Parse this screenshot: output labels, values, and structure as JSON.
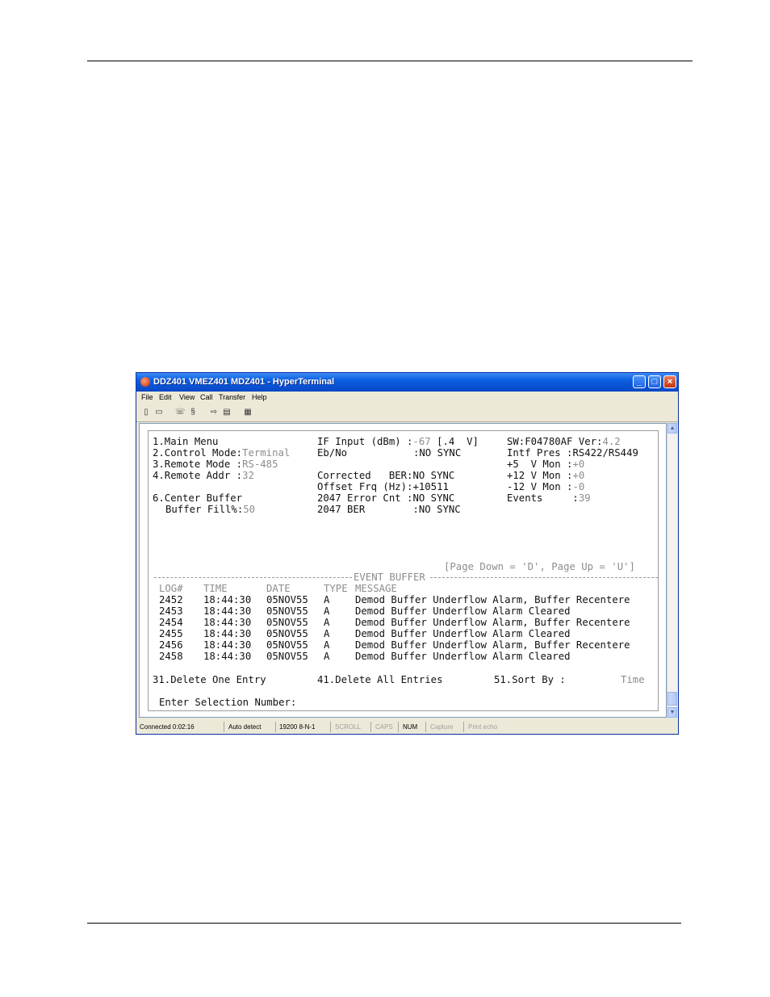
{
  "window": {
    "title": "DDZ401 VMEZ401 MDZ401 - HyperTerminal",
    "controls": {
      "minimize": "_",
      "maximize": "□",
      "close": "×"
    }
  },
  "menu": [
    "File",
    "Edit",
    "View",
    "Call",
    "Transfer",
    "Help"
  ],
  "toolbar_icons": [
    "new-icon",
    "open-icon",
    "disconnect-icon",
    "connect-icon",
    "send-icon",
    "receive-icon",
    "properties-icon"
  ],
  "terminal": {
    "menu_items": {
      "main_menu": "1.Main Menu",
      "control_mode_label": "2.Control Mode:",
      "control_mode_value": "Terminal",
      "remote_mode_label": "3.Remote Mode :",
      "remote_mode_value": "RS-485",
      "remote_addr_label": "4.Remote Addr :",
      "remote_addr_value": "32",
      "center_buffer": "6.Center Buffer",
      "buffer_fill_label": "Buffer Fill%:",
      "buffer_fill_value": "50"
    },
    "status": {
      "if_input_label": "IF Input (dBm) :",
      "if_input_value": "-67",
      "if_input_extra": "[.4  V]",
      "ebno_label": "Eb/No",
      "ebno_value": ":NO SYNC",
      "corrected_ber": "Corrected   BER:NO SYNC",
      "offset_frq": "Offset Frq (Hz):+10511",
      "error_cnt": "2047 Error Cnt :NO SYNC",
      "ber_2047": "2047 BER        :NO SYNC"
    },
    "system": {
      "sw_label": "SW:F04780AF Ver:",
      "sw_version": "4.2",
      "intf_pres_label": "Intf Pres :",
      "intf_pres_value": "RS422/RS449",
      "v5_label": "+5  V Mon :",
      "v5_value": "+0",
      "v12_label": "+12 V Mon :",
      "v12_value": "+0",
      "vm12_label": "-12 V Mon :",
      "vm12_value": "-0",
      "events_label": "Events     :",
      "events_value": "39"
    },
    "page_nav": "[Page Down = 'D', Page Up = 'U']",
    "event_buffer_title": "EVENT BUFFER",
    "columns": {
      "log": "LOG#",
      "time": "TIME",
      "date": "DATE",
      "type": "TYPE",
      "message": "MESSAGE"
    },
    "events": [
      {
        "log": "2452",
        "time": "18:44:30",
        "date": "05NOV55",
        "type": "A",
        "message": "Demod Buffer Underflow Alarm, Buffer Recentere"
      },
      {
        "log": "2453",
        "time": "18:44:30",
        "date": "05NOV55",
        "type": "A",
        "message": "Demod Buffer Underflow Alarm Cleared"
      },
      {
        "log": "2454",
        "time": "18:44:30",
        "date": "05NOV55",
        "type": "A",
        "message": "Demod Buffer Underflow Alarm, Buffer Recentere"
      },
      {
        "log": "2455",
        "time": "18:44:30",
        "date": "05NOV55",
        "type": "A",
        "message": "Demod Buffer Underflow Alarm Cleared"
      },
      {
        "log": "2456",
        "time": "18:44:30",
        "date": "05NOV55",
        "type": "A",
        "message": "Demod Buffer Underflow Alarm, Buffer Recentere"
      },
      {
        "log": "2458",
        "time": "18:44:30",
        "date": "05NOV55",
        "type": "A",
        "message": "Demod Buffer Underflow Alarm Cleared"
      }
    ],
    "actions": {
      "delete_one": "31.Delete One Entry",
      "delete_all": "41.Delete All Entries",
      "sort_by_label": "51.Sort By :",
      "sort_by_value": "Time"
    },
    "prompt": "Enter Selection Number:"
  },
  "statusbar": {
    "connected": "Connected 0:02:16",
    "detect": "Auto detect",
    "settings": "19200 8-N-1",
    "scroll": "SCROLL",
    "caps": "CAPS",
    "num": "NUM",
    "capture": "Capture",
    "print_echo": "Print echo"
  }
}
